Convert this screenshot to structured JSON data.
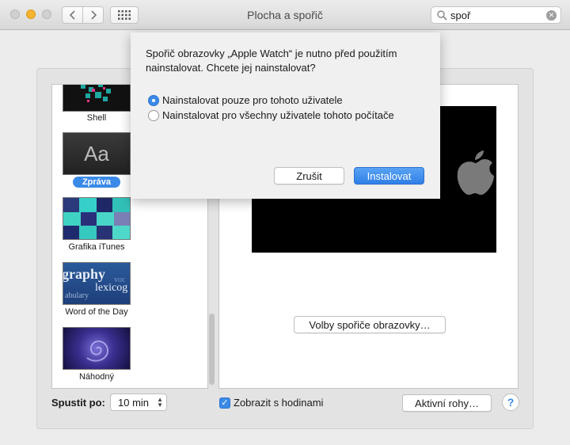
{
  "window": {
    "title": "Plocha a spořič"
  },
  "search": {
    "value": "spoř"
  },
  "savers": [
    {
      "label": "Shell"
    },
    {
      "label": "Zpráva",
      "thumb_text": "Aa",
      "selected": true
    },
    {
      "label": "Grafika iTunes"
    },
    {
      "label": "Word of the Day",
      "thumb_words": [
        "graphy",
        "lexicog",
        "voc",
        "abulary"
      ]
    },
    {
      "label": "Náhodný"
    }
  ],
  "preview": {
    "options_button": "Volby spořiče obrazovky…"
  },
  "bottom": {
    "start_label": "Spustit po:",
    "start_value": "10 min",
    "show_clock_label": "Zobrazit s hodinami",
    "show_clock_checked": true,
    "hot_corners_button": "Aktivní rohy…",
    "help_label": "?"
  },
  "dialog": {
    "message": "Spořič obrazovky „Apple Watch“ je nutno před použitím nainstalovat. Chcete jej nainstalovat?",
    "options": [
      {
        "label": "Nainstalovat pouze pro tohoto uživatele",
        "selected": true
      },
      {
        "label": "Nainstalovat pro všechny uživatele tohoto počítače",
        "selected": false
      }
    ],
    "cancel_button": "Zrušit",
    "install_button": "Instalovat"
  },
  "colors": {
    "accent": "#3b8ae8",
    "minimize": "#f8b42f"
  }
}
